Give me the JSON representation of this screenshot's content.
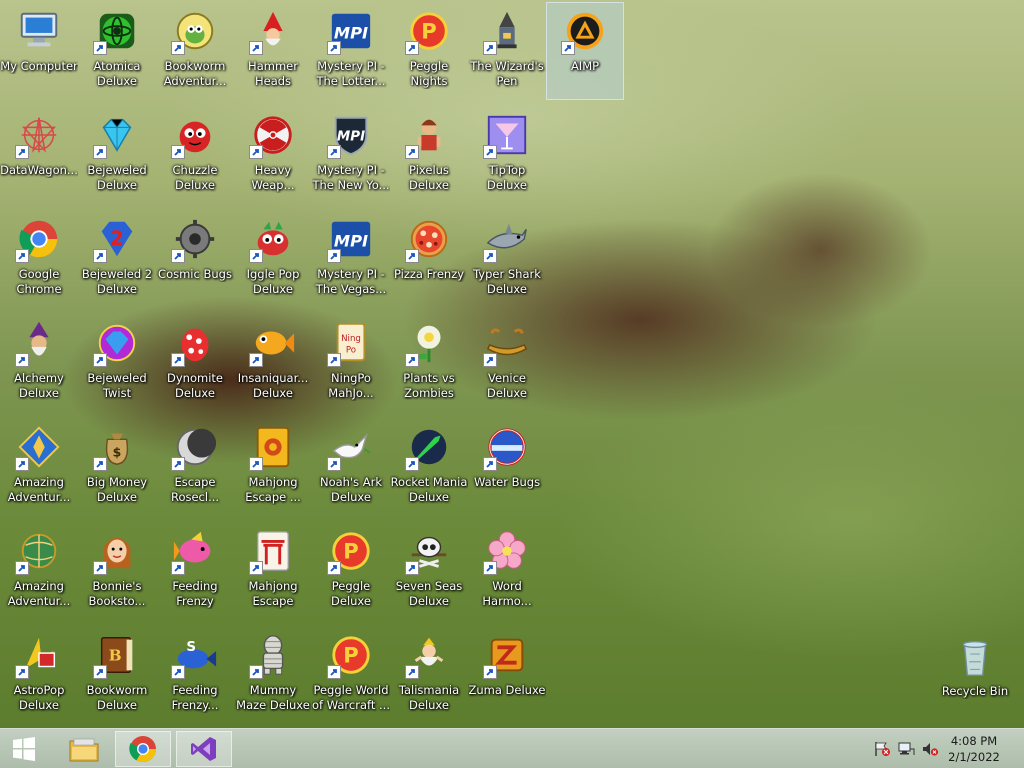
{
  "desktop": {
    "icons": [
      {
        "label": "My Computer",
        "icon": "computer-icon",
        "shortcut": false
      },
      {
        "label": "Atomica Deluxe",
        "icon": "atom-icon",
        "shortcut": true
      },
      {
        "label": "Bookworm Adventur...",
        "icon": "bookworm-icon",
        "shortcut": true
      },
      {
        "label": "Hammer Heads Deluxe",
        "icon": "gnome-icon",
        "shortcut": true
      },
      {
        "label": "Mystery PI - The Lotter...",
        "icon": "mpi-icon",
        "shortcut": true
      },
      {
        "label": "Peggle Nights Deluxe",
        "icon": "peggle-icon",
        "shortcut": true
      },
      {
        "label": "The Wizard's Pen",
        "icon": "wizard-pen-icon",
        "shortcut": true
      },
      {
        "label": "AIMP",
        "icon": "aimp-icon",
        "shortcut": true
      },
      {
        "label": "DataWagon...",
        "icon": "star-knot-icon",
        "shortcut": true
      },
      {
        "label": "Bejeweled Deluxe",
        "icon": "diamond-icon",
        "shortcut": true
      },
      {
        "label": "Chuzzle Deluxe",
        "icon": "chuzzle-icon",
        "shortcut": true
      },
      {
        "label": "Heavy Weap...",
        "icon": "radiation-icon",
        "shortcut": true
      },
      {
        "label": "Mystery PI - The New Yo...",
        "icon": "mpi-shield-icon",
        "shortcut": true
      },
      {
        "label": "Pixelus Deluxe",
        "icon": "pixelus-icon",
        "shortcut": true
      },
      {
        "label": "TipTop Deluxe",
        "icon": "cocktail-icon",
        "shortcut": true
      },
      {
        "label": "Google Chrome",
        "icon": "chrome-icon",
        "shortcut": true
      },
      {
        "label": "Bejeweled 2 Deluxe",
        "icon": "bejeweled2-icon",
        "shortcut": true
      },
      {
        "label": "Cosmic Bugs",
        "icon": "gear-bug-icon",
        "shortcut": true
      },
      {
        "label": "Iggle Pop Deluxe",
        "icon": "iggle-icon",
        "shortcut": true
      },
      {
        "label": "Mystery PI - The Vegas...",
        "icon": "mpi-icon",
        "shortcut": true
      },
      {
        "label": "Pizza Frenzy",
        "icon": "pizza-icon",
        "shortcut": true
      },
      {
        "label": "Typer Shark Deluxe",
        "icon": "shark-icon",
        "shortcut": true
      },
      {
        "label": "Alchemy Deluxe",
        "icon": "alchemist-icon",
        "shortcut": true
      },
      {
        "label": "Bejeweled Twist",
        "icon": "twist-gem-icon",
        "shortcut": true
      },
      {
        "label": "Dynomite Deluxe",
        "icon": "egg-icon",
        "shortcut": true
      },
      {
        "label": "Insaniquar... Deluxe",
        "icon": "fish-icon",
        "shortcut": true
      },
      {
        "label": "NingPo MahJo...",
        "icon": "mahjong-tile-icon",
        "shortcut": true
      },
      {
        "label": "Plants vs Zombies",
        "icon": "flower-icon",
        "shortcut": true
      },
      {
        "label": "Venice Deluxe",
        "icon": "gondola-icon",
        "shortcut": true
      },
      {
        "label": "Amazing Adventur...",
        "icon": "compass-gem-icon",
        "shortcut": true
      },
      {
        "label": "Big Money Deluxe",
        "icon": "money-bag-icon",
        "shortcut": true
      },
      {
        "label": "Escape Rosecl...",
        "icon": "crescent-icon",
        "shortcut": true
      },
      {
        "label": "Mahjong Escape ...",
        "icon": "gold-tile-icon",
        "shortcut": true
      },
      {
        "label": "Noah's Ark Deluxe",
        "icon": "dove-icon",
        "shortcut": true
      },
      {
        "label": "Rocket Mania Deluxe",
        "icon": "rocket-icon",
        "shortcut": true
      },
      {
        "label": "Water Bugs",
        "icon": "water-orb-icon",
        "shortcut": true
      },
      {
        "label": "Amazing Adventur...",
        "icon": "globe-icon",
        "shortcut": true
      },
      {
        "label": "Bonnie's Booksto...",
        "icon": "girl-icon",
        "shortcut": true
      },
      {
        "label": "Feeding Frenzy Deluxe",
        "icon": "fish-pink-icon",
        "shortcut": true
      },
      {
        "label": "Mahjong Escape Anci...",
        "icon": "torii-icon",
        "shortcut": true
      },
      {
        "label": "Peggle Deluxe",
        "icon": "peggle-icon",
        "shortcut": true
      },
      {
        "label": "Seven Seas Deluxe",
        "icon": "skull-icon",
        "shortcut": true
      },
      {
        "label": "Word Harmo...",
        "icon": "blossom-icon",
        "shortcut": true
      },
      {
        "label": "AstroPop Deluxe",
        "icon": "astropop-icon",
        "shortcut": true
      },
      {
        "label": "Bookworm Deluxe",
        "icon": "book-icon",
        "shortcut": true
      },
      {
        "label": "Feeding Frenzy...",
        "icon": "fish-blue-icon",
        "shortcut": true
      },
      {
        "label": "Mummy Maze Deluxe",
        "icon": "mummy-icon",
        "shortcut": true
      },
      {
        "label": "Peggle World of Warcraft ...",
        "icon": "peggle-icon",
        "shortcut": true
      },
      {
        "label": "Talismania Deluxe",
        "icon": "genie-icon",
        "shortcut": true
      },
      {
        "label": "Zuma Deluxe",
        "icon": "zuma-icon",
        "shortcut": true
      }
    ],
    "recycle_bin": {
      "label": "Recycle Bin",
      "icon": "recycle-bin-icon"
    }
  },
  "taskbar": {
    "start_icon": "windows-logo-icon",
    "pinned": [
      {
        "name": "file-explorer",
        "icon": "folder-icon",
        "active": false
      },
      {
        "name": "google-chrome",
        "icon": "chrome-icon",
        "active": true
      },
      {
        "name": "visual-studio",
        "icon": "visual-studio-icon",
        "active": true
      }
    ],
    "tray": [
      "action-center-flag-icon",
      "network-icon",
      "volume-muted-icon"
    ],
    "time": "4:08 PM",
    "date": "2/1/2022"
  },
  "colors": {
    "grass": "#6b8a3a",
    "puppy": "#4e2a1c",
    "selection": "#b4d2f0",
    "taskbar": "#b9c7b8"
  }
}
